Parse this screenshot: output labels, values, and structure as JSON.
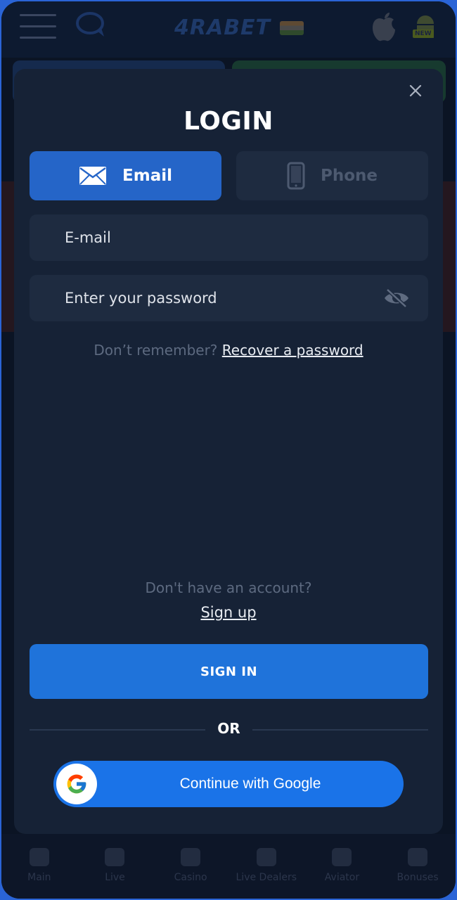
{
  "header": {
    "brand": "4RABET",
    "new_badge": "NEW"
  },
  "bottom_nav": {
    "items": [
      {
        "label": "Main"
      },
      {
        "label": "Live"
      },
      {
        "label": "Casino"
      },
      {
        "label": "Live Dealers"
      },
      {
        "label": "Aviator"
      },
      {
        "label": "Bonuses"
      }
    ]
  },
  "login": {
    "title": "LOGIN",
    "tabs": {
      "email": "Email",
      "phone": "Phone"
    },
    "email_placeholder": "E-mail",
    "password_placeholder": "Enter your password",
    "recover_prompt": "Don’t remember?",
    "recover_link": "Recover a password",
    "no_account": "Don't have an account?",
    "signup_link": "Sign up",
    "signin_label": "SIGN IN",
    "or_label": "OR",
    "google_label": "Continue with Google"
  },
  "colors": {
    "modal_bg": "#162236",
    "tab_active": "#2565c8",
    "signin": "#1f73da",
    "google": "#1a73e8"
  }
}
